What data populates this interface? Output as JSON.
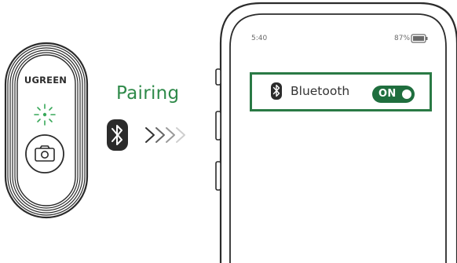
{
  "remote": {
    "brand": "UGREEN",
    "icons": [
      "status-light-icon",
      "camera-shutter-icon"
    ]
  },
  "pairing": {
    "label": "Pairing",
    "icons": [
      "bluetooth-icon",
      "chevron-right-icon"
    ]
  },
  "phone": {
    "status_time": "5:40",
    "status_battery": "87%",
    "bluetooth_row": {
      "label": "Bluetooth",
      "toggle_label": "ON",
      "icon": "bluetooth-icon"
    }
  },
  "colors": {
    "accent_green": "#2a7a45",
    "toggle_green": "#1f6e3e",
    "text_green": "#2f8a4a",
    "outline": "#333333"
  }
}
